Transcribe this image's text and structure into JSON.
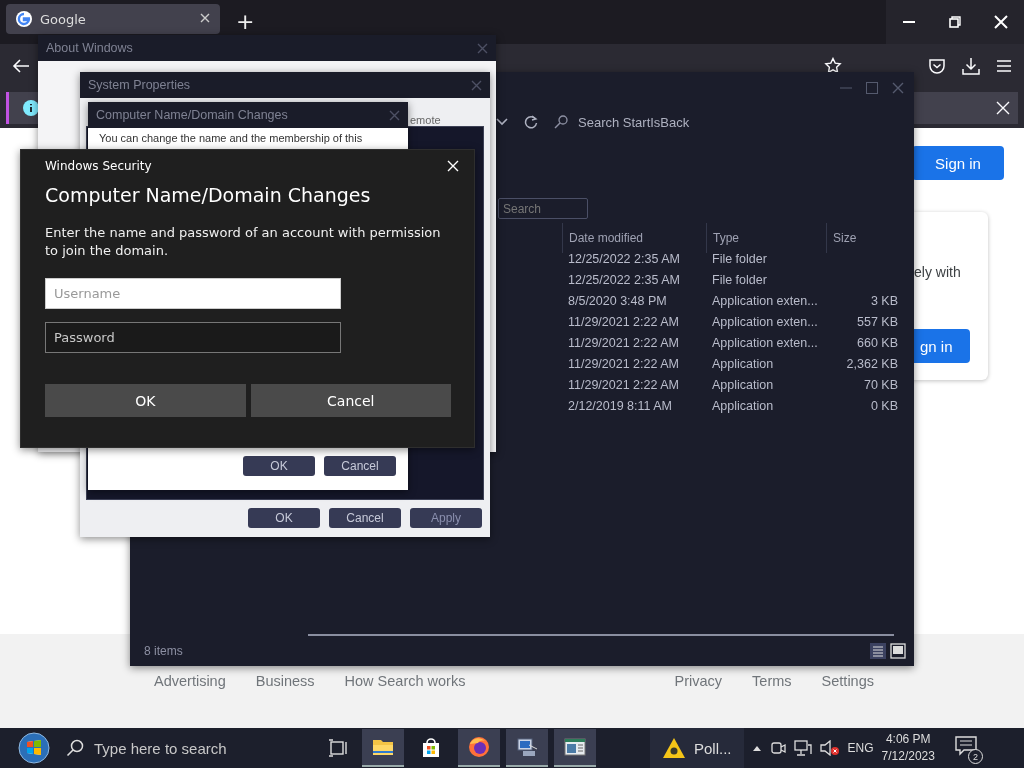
{
  "browser": {
    "tabs": [
      {
        "title": "Google",
        "selected": true
      }
    ],
    "new_tab": "+",
    "page": {
      "sign_in": "Sign in",
      "card_text": "ely with",
      "card_button": "gn in"
    },
    "footer": {
      "left_links": [
        "Advertising",
        "Business",
        "How Search works"
      ],
      "right_links": [
        "Privacy",
        "Terms",
        "Settings"
      ]
    }
  },
  "explorer": {
    "search_placeholder": "Search StartIsBack",
    "filter_placeholder": "Search",
    "columns": [
      "Date modified",
      "Type",
      "Size"
    ],
    "rows": [
      {
        "date": "12/25/2022 2:35 AM",
        "type": "File folder",
        "size": ""
      },
      {
        "date": "12/25/2022 2:35 AM",
        "type": "File folder",
        "size": ""
      },
      {
        "date": "8/5/2020 3:48 PM",
        "type": "Application exten...",
        "size": "3 KB"
      },
      {
        "date": "11/29/2021 2:22 AM",
        "type": "Application exten...",
        "size": "557 KB"
      },
      {
        "date": "11/29/2021 2:22 AM",
        "type": "Application exten...",
        "size": "660 KB"
      },
      {
        "date": "11/29/2021 2:22 AM",
        "type": "Application",
        "size": "2,362 KB"
      },
      {
        "date": "11/29/2021 2:22 AM",
        "type": "Application",
        "size": "70 KB"
      },
      {
        "date": "2/12/2019 8:11 AM",
        "type": "Application",
        "size": "0 KB"
      }
    ],
    "status": "8 items"
  },
  "about_window": {
    "title": "About Windows"
  },
  "system_properties": {
    "title": "System Properties",
    "tab_fragment": "emote",
    "buttons": [
      {
        "label": "OK",
        "disabled": false
      },
      {
        "label": "Cancel",
        "disabled": false
      },
      {
        "label": "Apply",
        "disabled": true
      }
    ]
  },
  "domain_changes": {
    "title": "Computer Name/Domain Changes",
    "text": "You can change the name and the membership of this",
    "buttons": [
      {
        "label": "OK",
        "disabled": false
      },
      {
        "label": "Cancel",
        "disabled": false
      }
    ]
  },
  "security_dialog": {
    "caption": "Windows Security",
    "heading": "Computer Name/Domain Changes",
    "message": "Enter the name and password of an account with permission to join the domain.",
    "username": {
      "placeholder": "Username"
    },
    "password": {
      "placeholder": "Password"
    },
    "buttons": [
      {
        "label": "OK"
      },
      {
        "label": "Cancel"
      }
    ]
  },
  "taskbar": {
    "search_placeholder": "Type here to search",
    "apps": [
      {
        "kind": "explorer",
        "open": true
      },
      {
        "kind": "store",
        "open": false
      },
      {
        "kind": "firefox",
        "open": true
      },
      {
        "kind": "system",
        "open": true
      },
      {
        "kind": "monitor",
        "open": true
      }
    ],
    "notification_app": "Poll...",
    "language": "ENG",
    "time": "4:06 PM",
    "date": "7/12/2023",
    "notification_count": "2"
  }
}
